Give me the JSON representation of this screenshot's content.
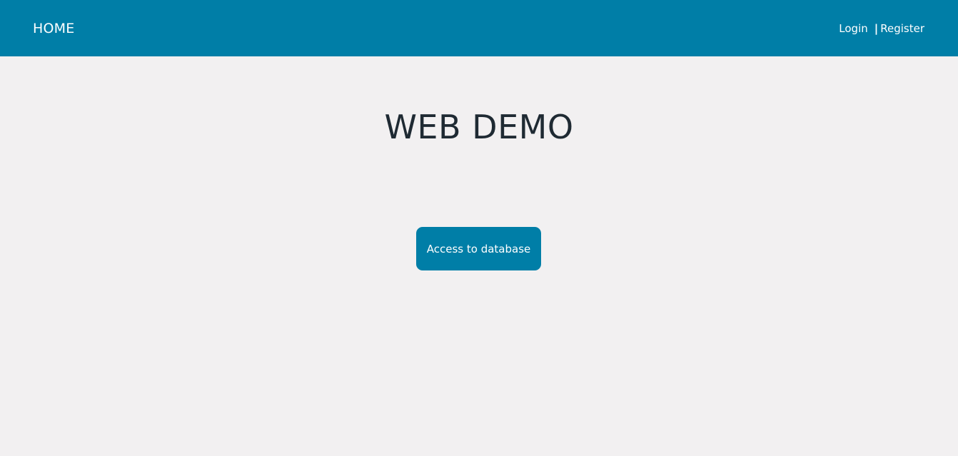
{
  "navbar": {
    "home_label": "HOME",
    "login_label": "Login",
    "separator": "|",
    "register_label": "Register",
    "background_color": "#007ea7"
  },
  "main": {
    "title": "WEB DEMO",
    "access_button_label": "Access to database",
    "button_color": "#007ea7",
    "page_background": "#f2f0f1"
  }
}
